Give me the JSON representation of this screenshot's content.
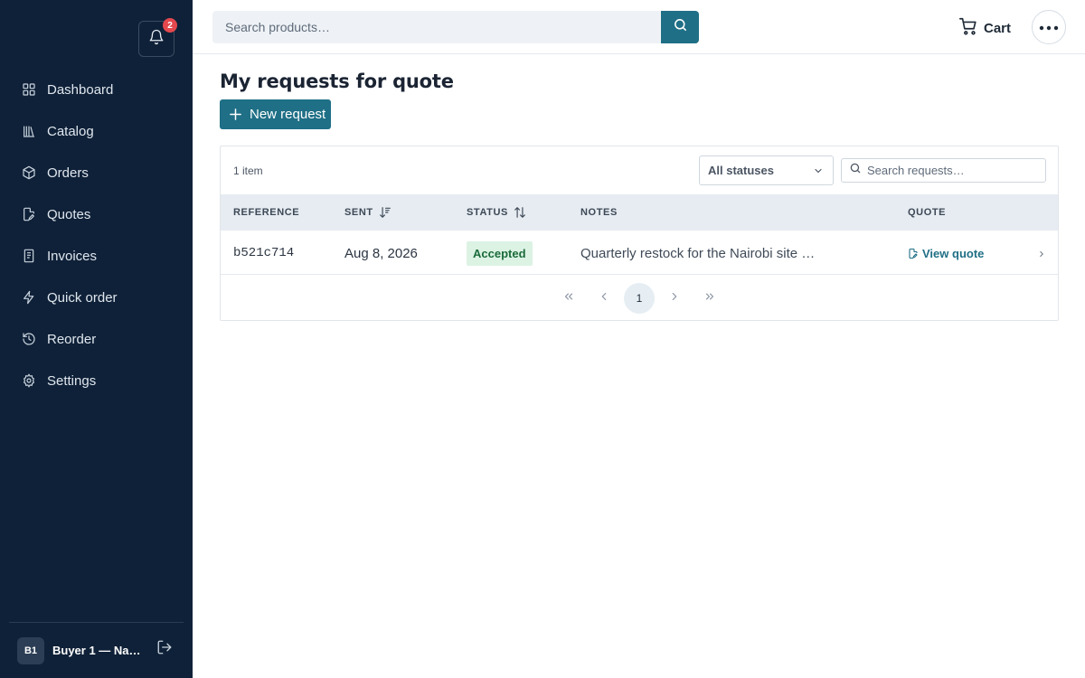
{
  "sidebar": {
    "notifications_count": "2",
    "items": [
      {
        "label": "Dashboard",
        "icon": "dashboard-grid-icon"
      },
      {
        "label": "Catalog",
        "icon": "catalog-books-icon"
      },
      {
        "label": "Orders",
        "icon": "box-icon"
      },
      {
        "label": "Quotes",
        "icon": "quote-document-icon"
      },
      {
        "label": "Invoices",
        "icon": "invoice-receipt-icon"
      },
      {
        "label": "Quick order",
        "icon": "lightning-icon"
      },
      {
        "label": "Reorder",
        "icon": "history-icon"
      },
      {
        "label": "Settings",
        "icon": "gear-icon"
      }
    ],
    "user": {
      "initials": "B1",
      "name": "Buyer 1 — Nair…"
    }
  },
  "topbar": {
    "search_placeholder": "Search products…",
    "cart_label": "Cart"
  },
  "main": {
    "title": "My requests for quote",
    "new_request_label": "New request",
    "item_count": "1 item",
    "status_filter": "All statuses",
    "search_placeholder": "Search requests…",
    "columns": {
      "reference": "REFERENCE",
      "sent": "SENT",
      "status": "STATUS",
      "notes": "NOTES",
      "quote": "QUOTE"
    },
    "rows": [
      {
        "reference": "b521c714",
        "sent": "Aug 8, 2026",
        "status": "Accepted",
        "notes": "Quarterly restock for the Nairobi site …",
        "quote_link": "View quote"
      }
    ],
    "pagination": {
      "current_page": "1"
    }
  },
  "colors": {
    "sidebar_bg": "#0f2138",
    "accent": "#1f6f86",
    "badge_bg": "#e5484d",
    "status_accepted_bg": "#dcf3e4",
    "status_accepted_text": "#1b6b3a",
    "table_header_bg": "#e6ecf1"
  }
}
